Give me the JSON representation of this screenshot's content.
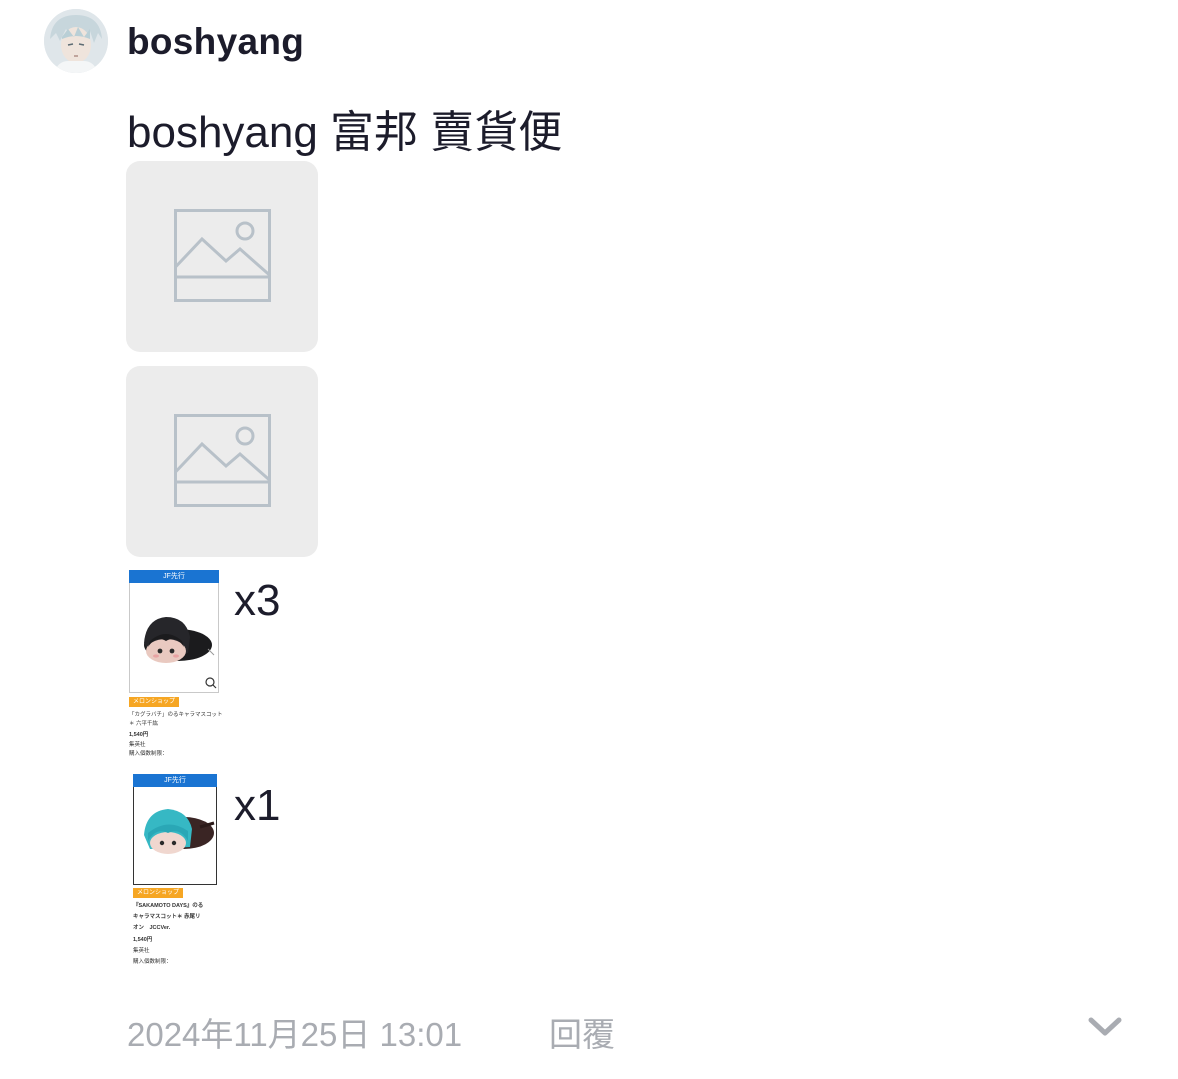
{
  "post": {
    "username": "boshyang",
    "text": "boshyang 富邦 賣貨便",
    "timestamp": "2024年11月25日 13:01",
    "reply_label": "回覆",
    "expand_icon": "chevron-down-icon"
  },
  "attachments": [
    {
      "type": "image-placeholder",
      "icon": "image-placeholder-icon"
    },
    {
      "type": "image-placeholder",
      "icon": "image-placeholder-icon"
    }
  ],
  "products": [
    {
      "header": "JF先行",
      "shop_tag": "メロンショップ",
      "title_lines": [
        "「カグラバチ」のるキャラマスコット",
        "＊ 六平千紘"
      ],
      "price": "1,540円",
      "publisher": "集英社",
      "limit": "購入個数制限：",
      "quantity": "x3"
    },
    {
      "header": "JF先行",
      "shop_tag": "メロンショップ",
      "title_lines": [
        "『SAKAMOTO DAYS』のる",
        "キャラマスコット＊ 赤尾リ",
        "オン　JCCVer."
      ],
      "price": "1,540円",
      "publisher": "集英社",
      "limit": "購入個数制限：",
      "quantity": "x1"
    }
  ],
  "colors": {
    "text": "#1c1c2b",
    "muted": "#a9acb2",
    "placeholder_bg": "#ececec",
    "placeholder_icon": "#b8c1c9",
    "header_blue": "#1a74d2",
    "tag_orange": "#f6a623"
  }
}
